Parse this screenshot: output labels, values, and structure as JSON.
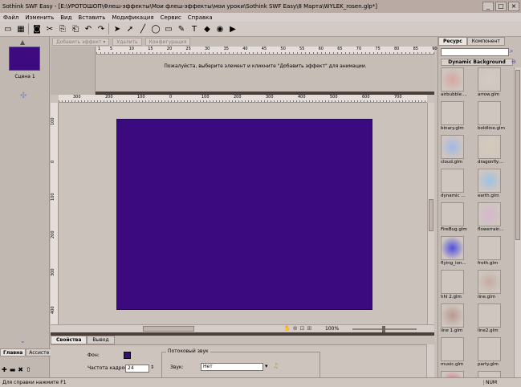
{
  "window": {
    "title": "Sothink SWF Easy - [E:\\УРОТОШОП\\Флеш-эффекты\\Мои флеш-эффекты\\мои уроки\\Sothink SWF Easy\\8 Марта\\WYLEK_rosen.glp*]",
    "btn_min": "_",
    "btn_max": "□",
    "btn_close": "×"
  },
  "menu": [
    "Файл",
    "Изменить",
    "Вид",
    "Вставить",
    "Модификация",
    "Сервис",
    "Справка"
  ],
  "toolbar": {
    "icons": [
      "new-file-icon",
      "open-icon",
      "save-icon",
      "cut-icon",
      "copy-icon",
      "paste-icon",
      "undo-icon",
      "redo-icon",
      "select-icon",
      "subselect-icon",
      "line-icon",
      "ellipse-icon",
      "rectangle-icon",
      "pencil-icon",
      "text-icon",
      "fill-icon",
      "preview-icon",
      "publish-icon"
    ],
    "glyphs": [
      "▭",
      "▦",
      "◙",
      "✂",
      "⎘",
      "⎗",
      "↶",
      "↷",
      "➤",
      "➚",
      "╱",
      "◯",
      "▭",
      "✎",
      "T",
      "◆",
      "◉",
      "▶"
    ]
  },
  "scenes": {
    "label": "Сцена 1"
  },
  "left_tabs": [
    "Главна",
    "Ассисте"
  ],
  "effects": {
    "add_label": "Добавить эффект ▾",
    "delete_label": "Удалить",
    "config_label": "Конфигурация",
    "message": "Пожалуйста, выберите элемент и кликните \"Добавить эффект\" для анимации.",
    "ruler_labels": [
      "1",
      "5",
      "10",
      "15",
      "20",
      "25",
      "30",
      "35",
      "40",
      "45",
      "50",
      "55",
      "60",
      "65",
      "70",
      "75",
      "80",
      "85",
      "90"
    ]
  },
  "canvas": {
    "hruler_labels": [
      "300",
      "200",
      "100",
      "0",
      "100",
      "200",
      "300",
      "400",
      "500",
      "600",
      "700"
    ],
    "vruler_labels": [
      "100",
      "0",
      "100",
      "200",
      "300",
      "400"
    ],
    "zoom": "100%",
    "stage_color": "#3c0a7f"
  },
  "props": {
    "tabs": [
      "Свойства",
      "Вывод"
    ],
    "bg_label": "Фон:",
    "fps_label": "Частота кадров:",
    "fps_value": "24",
    "stream_group": "Потоковый звук",
    "sound_label": "Звук:",
    "sound_value": "Нет"
  },
  "resources": {
    "tabs": [
      "Ресурс",
      "Компонент"
    ],
    "category": "Dynamic Background",
    "items": [
      {
        "name": "airbubble....",
        "color": "#d7a7a0"
      },
      {
        "name": "arrow.glm",
        "color": "#d3cac4"
      },
      {
        "name": "binary.glm",
        "color": "#cfc6c0"
      },
      {
        "name": "boldline.glm",
        "color": "#cfc6c0"
      },
      {
        "name": "cloud.glm",
        "color": "#9fb9e6"
      },
      {
        "name": "dragonfly....",
        "color": "#d6cbb8"
      },
      {
        "name": "dynamic ...",
        "color": "#cfc6c0"
      },
      {
        "name": "earth.glm",
        "color": "#9cc3e4"
      },
      {
        "name": "FireBug.glm",
        "color": "#cfc6c0"
      },
      {
        "name": "flowerrain...",
        "color": "#d6b6cf"
      },
      {
        "name": "flying_ion...",
        "color": "#4f4fe0"
      },
      {
        "name": "froth.glm",
        "color": "#cfc6c0"
      },
      {
        "name": "hhl 2.glm",
        "color": "#cfc6c0"
      },
      {
        "name": "line.glm",
        "color": "#c4aca0"
      },
      {
        "name": "line 1.glm",
        "color": "#b89a8e"
      },
      {
        "name": "line2.glm",
        "color": "#cfc6c0"
      },
      {
        "name": "music.glm",
        "color": "#cfc6c0"
      },
      {
        "name": "party.glm",
        "color": "#cfc6c0"
      },
      {
        "name": "",
        "color": "#e0607a"
      },
      {
        "name": "",
        "color": "#cfc6c0"
      }
    ]
  },
  "status": {
    "help": "Для справки нажмите F1",
    "num": "NUM"
  }
}
